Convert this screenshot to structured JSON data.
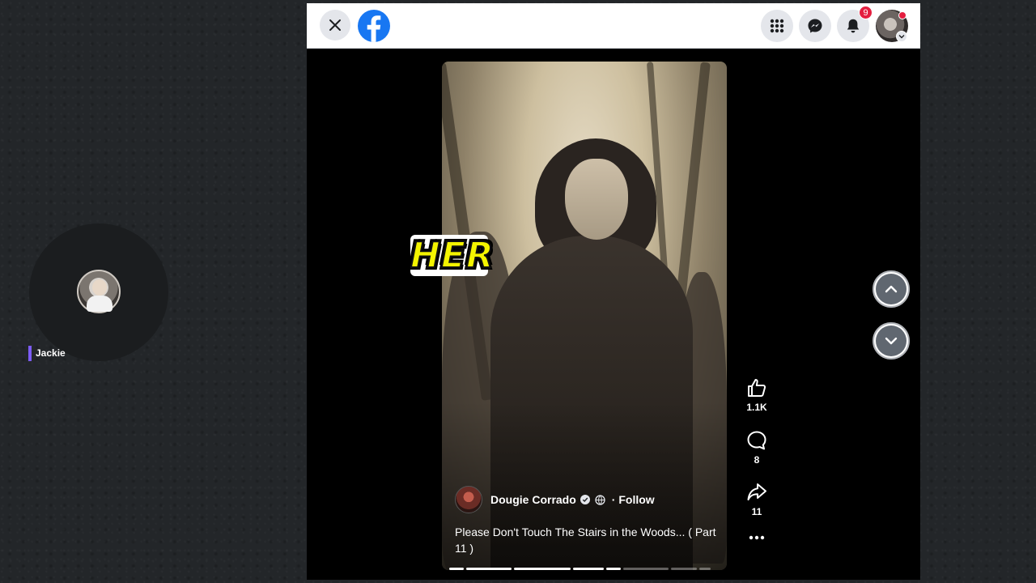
{
  "webcam": {
    "name": "Jackie",
    "name_bar_color": "#7c5cf5",
    "icon": "user-avatar"
  },
  "topbar": {
    "close_icon": "close-icon",
    "logo_icon": "facebook-logo",
    "menu_icon": "grid-menu-icon",
    "messenger_icon": "messenger-icon",
    "notifications_icon": "bell-icon",
    "notifications_count": "9",
    "profile_icon": "profile-avatar",
    "brand_color": "#1877f2",
    "badge_color": "#e41e3f"
  },
  "reel": {
    "overlay_word": "HER",
    "author": {
      "name": "Dougie Corrado",
      "verified": true,
      "follow_label": "Follow",
      "separator": "·"
    },
    "description": "Please Don't Touch The Stairs in the Woods... ( Part 11 )",
    "progress_segments_watched": 4
  },
  "actions": {
    "likes": "1.1K",
    "comments": "8",
    "shares": "11",
    "more_icon": "more-icon"
  },
  "navigation": {
    "up_icon": "chevron-up-icon",
    "down_icon": "chevron-down-icon"
  }
}
